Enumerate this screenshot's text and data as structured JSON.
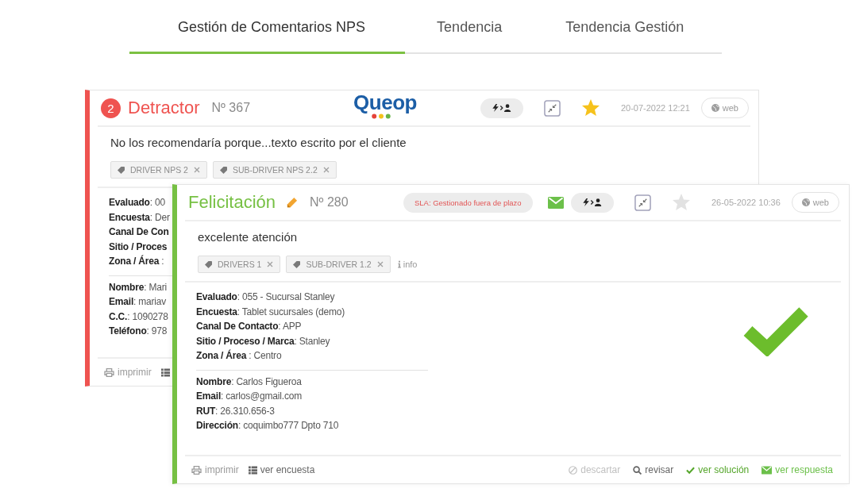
{
  "tabs": [
    {
      "label": "Gestión de Comentarios NPS",
      "selected": true
    },
    {
      "label": "Tendencia",
      "selected": false
    },
    {
      "label": "Tendencia Gestión",
      "selected": false
    }
  ],
  "cards": [
    {
      "kind": "detractor",
      "badge": "2",
      "title": "Detractor",
      "editable": false,
      "number": "Nº 367",
      "logo": "Queop",
      "mail_sent": false,
      "starred": true,
      "date": "20-07-2022 12:21",
      "channel": "web",
      "comment": "No los recomendaría porque...texto escrito por el cliente",
      "tags": [
        "DRIVER NPS 2",
        "SUB-DRIVER NPS 2.2"
      ],
      "survey_fields": [
        {
          "label": "Evaluado",
          "value": ": 00"
        },
        {
          "label": "Encuesta",
          "value": ": Der"
        },
        {
          "label": "Canal De Con"
        },
        {
          "label": "Sitio / Proces"
        },
        {
          "label": "Zona / Área",
          "value": " :"
        }
      ],
      "customer_fields": [
        {
          "label": "Nombre",
          "value": ": Mari"
        },
        {
          "label": "Email",
          "value": ": mariav"
        },
        {
          "label": "C.C.",
          "value": ": 1090278"
        },
        {
          "label": "Teléfono",
          "value": ": 978"
        }
      ],
      "actions": [
        {
          "kind": "print",
          "label": "imprimir"
        },
        {
          "kind": "survey"
        }
      ]
    },
    {
      "kind": "praise",
      "title": "Felicitación",
      "editable": true,
      "number": "Nº 280",
      "sla": "SLA: Gestionado fuera de plazo",
      "mail_sent": true,
      "starred": false,
      "date": "26-05-2022 10:36",
      "channel": "web",
      "comment": "excelente atención",
      "tags": [
        "DRIVERS 1",
        "SUB-DRIVER 1.2"
      ],
      "info": "info",
      "survey_fields": [
        {
          "label": "Evaluado",
          "value": ": 055 - Sucursal Stanley"
        },
        {
          "label": "Encuesta",
          "value": ": Tablet sucursales (demo)"
        },
        {
          "label": "Canal De Contacto",
          "value": ": APP"
        },
        {
          "label": "Sitio / Proceso / Marca",
          "value": ": Stanley"
        },
        {
          "label": "Zona / Área",
          "value": " : Centro"
        }
      ],
      "customer_fields": [
        {
          "label": "Nombre",
          "value": ": Carlos Figueroa"
        },
        {
          "label": "Email",
          "value": ": carlos@gmail.com"
        },
        {
          "label": "RUT",
          "value": ": 26.310.656-3"
        },
        {
          "label": "Dirección",
          "value": ": coquimbo777 Dpto 710"
        }
      ],
      "resolved": true,
      "actions": [
        {
          "kind": "print",
          "label": "imprimir"
        },
        {
          "kind": "survey",
          "label": "ver encuesta"
        }
      ],
      "status_actions": [
        {
          "kind": "discard",
          "label": "descartar"
        },
        {
          "kind": "review",
          "label": "revisar"
        },
        {
          "kind": "solution",
          "label": "ver solución"
        },
        {
          "kind": "response",
          "label": "ver respuesta"
        }
      ]
    }
  ]
}
